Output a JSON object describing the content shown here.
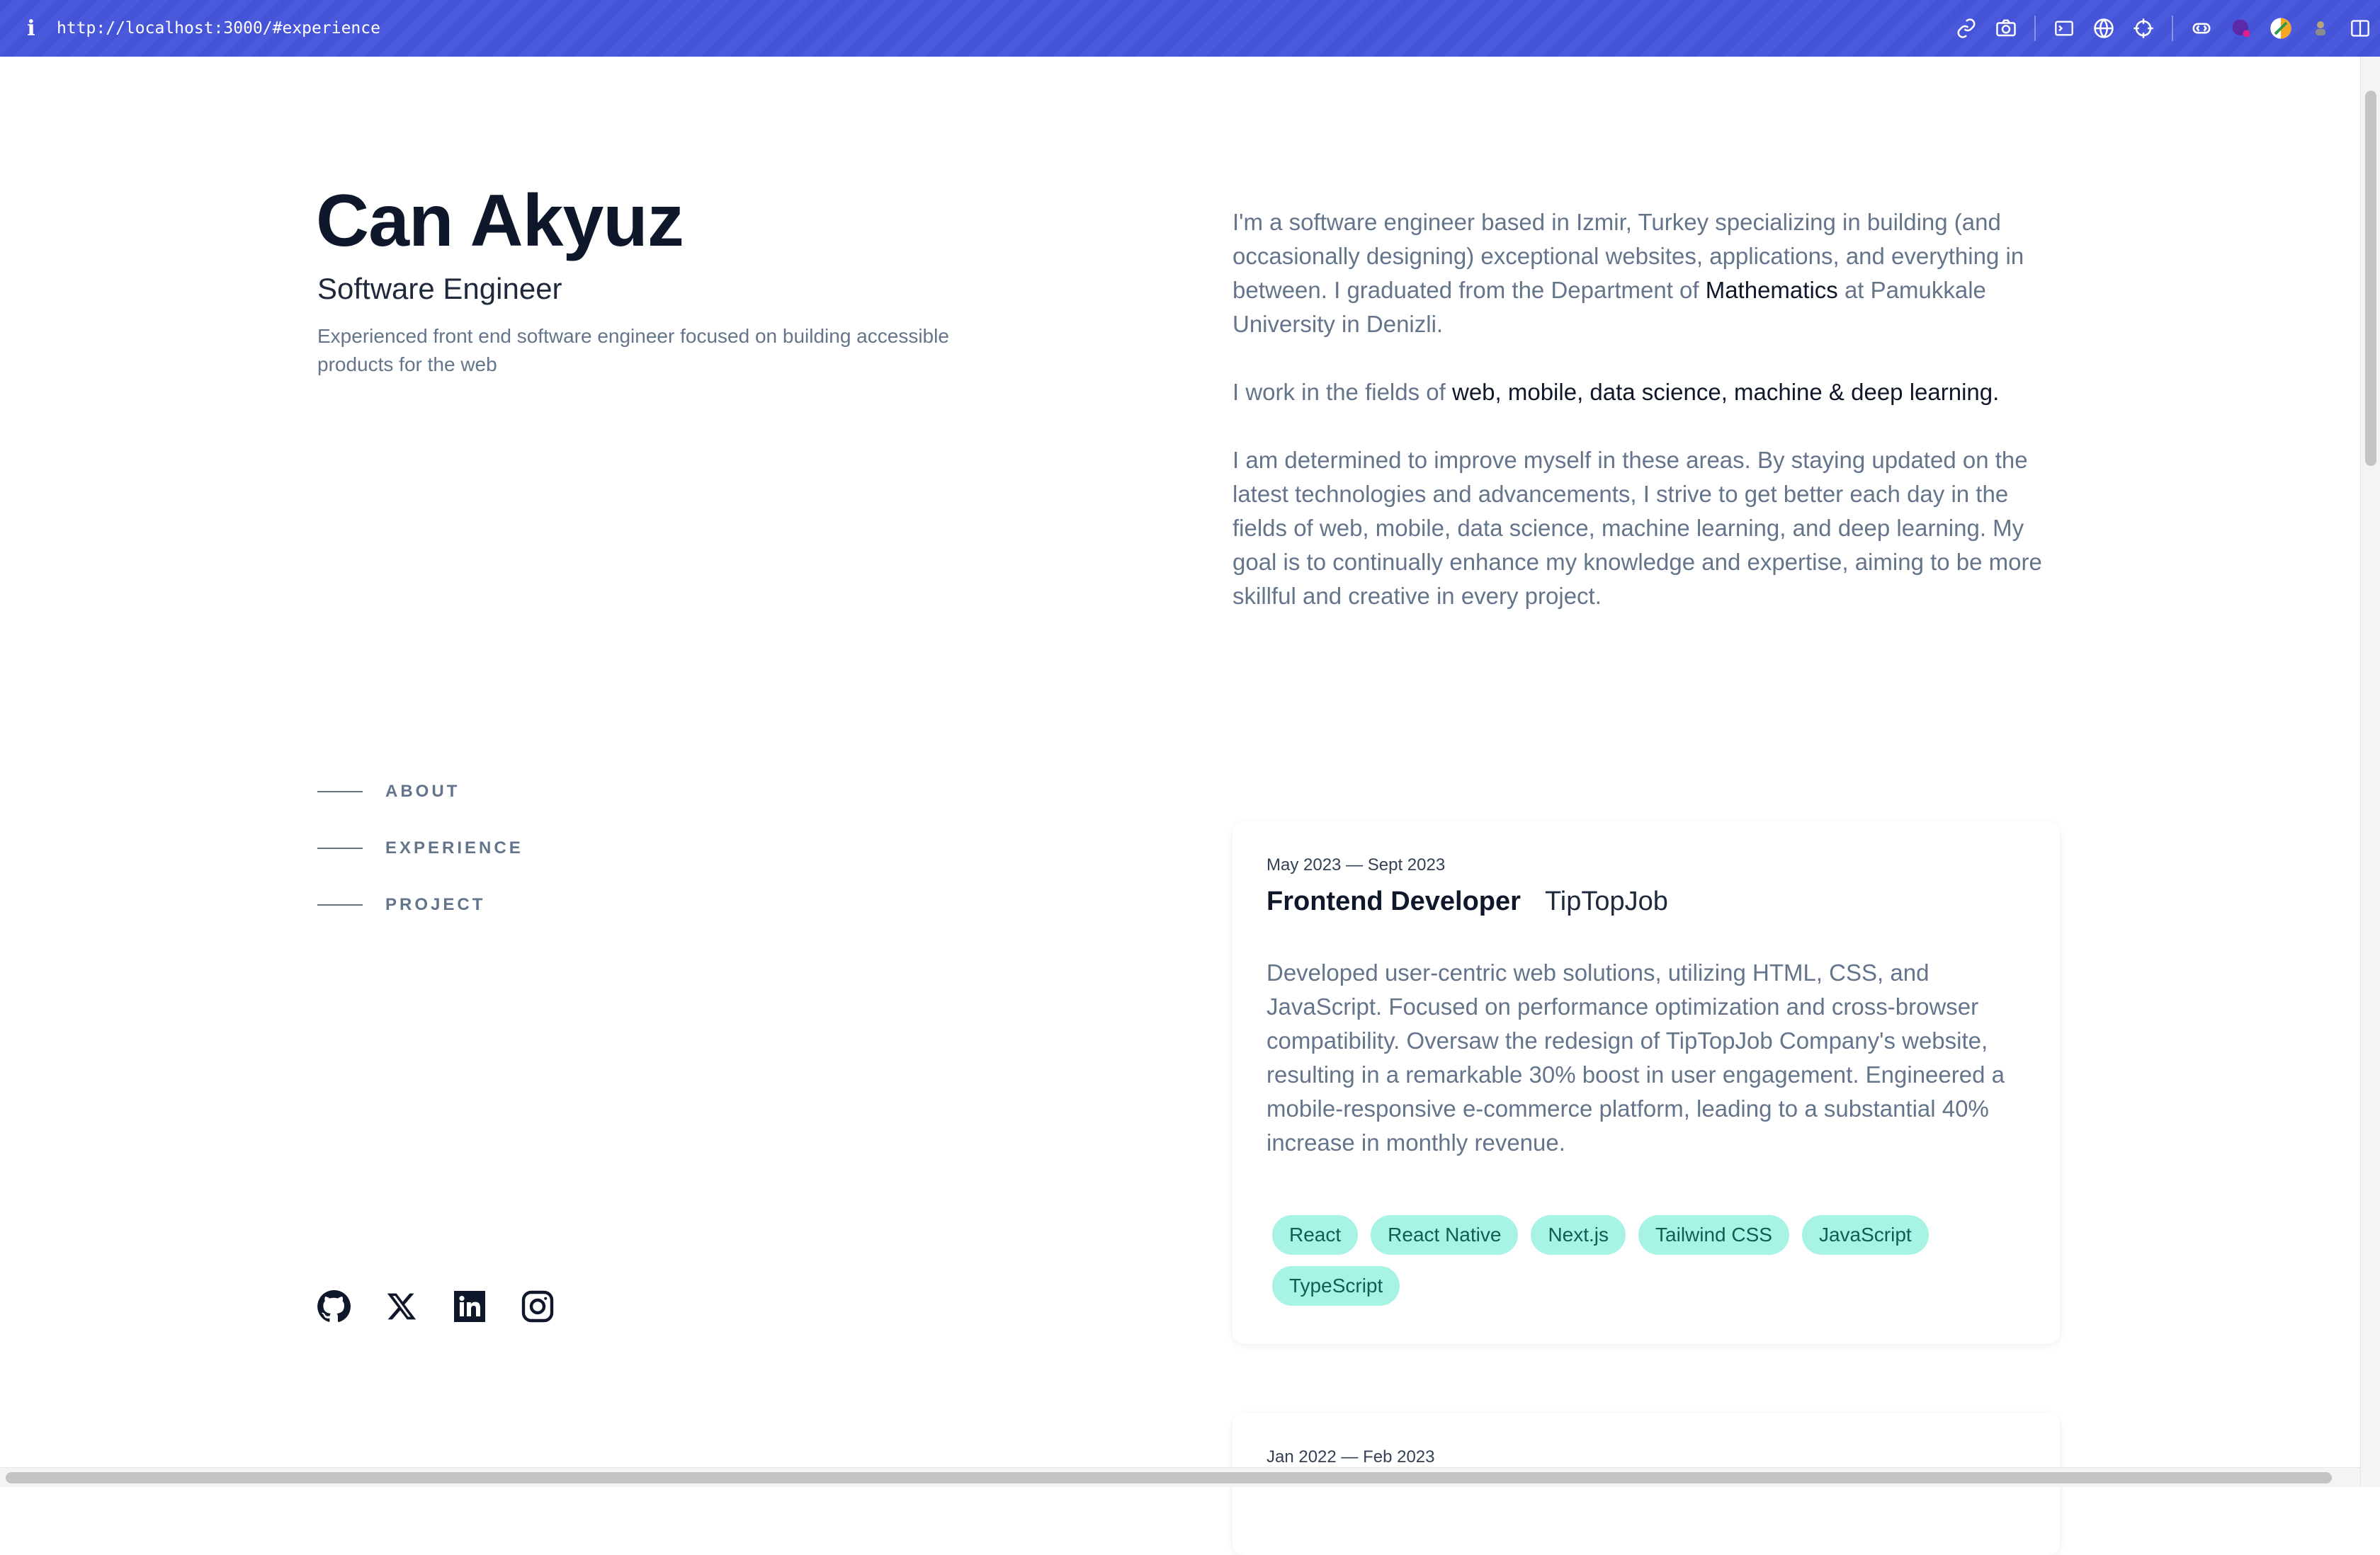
{
  "browser": {
    "url": "http://localhost:3000/#experience",
    "info_glyph": "i",
    "toolbar_icons": [
      "link-icon",
      "camera-icon",
      "terminal-icon",
      "globe-icon",
      "crosshair-icon",
      "extension-icon",
      "profile-icon",
      "color-icon",
      "user-icon",
      "sidebar-icon"
    ]
  },
  "header": {
    "name": "Can Akyuz",
    "role": "Software Engineer",
    "tagline": "Experienced front end software engineer focused on building accessible products for the web"
  },
  "nav": {
    "items": [
      {
        "label": "ABOUT"
      },
      {
        "label": "EXPERIENCE"
      },
      {
        "label": "PROJECT"
      }
    ]
  },
  "socials": [
    "github-icon",
    "x-icon",
    "linkedin-icon",
    "instagram-icon"
  ],
  "about": {
    "p1_a": "I'm a software engineer based in Izmir, Turkey specializing in building (and occasionally designing) exceptional websites, applications, and everything in between. I graduated from the Department of ",
    "p1_hl": "Mathematics",
    "p1_b": " at Pamukkale University in Denizli.",
    "p2_a": "I work in the fields of ",
    "p2_hl": "web, mobile, data science, machine & deep learning.",
    "p3": "I am determined to improve myself in these areas. By staying updated on the latest technologies and advancements, I strive to get better each day in the fields of web, mobile, data science, machine learning, and deep learning. My goal is to continually enhance my knowledge and expertise, aiming to be more skillful and creative in every project."
  },
  "experience": [
    {
      "date": "May 2023 — Sept 2023",
      "title": "Frontend Developer",
      "company": "TipTopJob",
      "description": "Developed user-centric web solutions, utilizing HTML, CSS, and JavaScript. Focused on performance optimization and cross-browser compatibility. Oversaw the redesign of TipTopJob Company's website, resulting in a remarkable 30% boost in user engagement. Engineered a mobile-responsive e-commerce platform, leading to a substantial 40% increase in monthly revenue.",
      "tags": [
        "React",
        "React Native",
        "Next.js",
        "Tailwind CSS",
        "JavaScript",
        "TypeScript"
      ]
    },
    {
      "date": "Jan 2022 — Feb 2023"
    }
  ]
}
